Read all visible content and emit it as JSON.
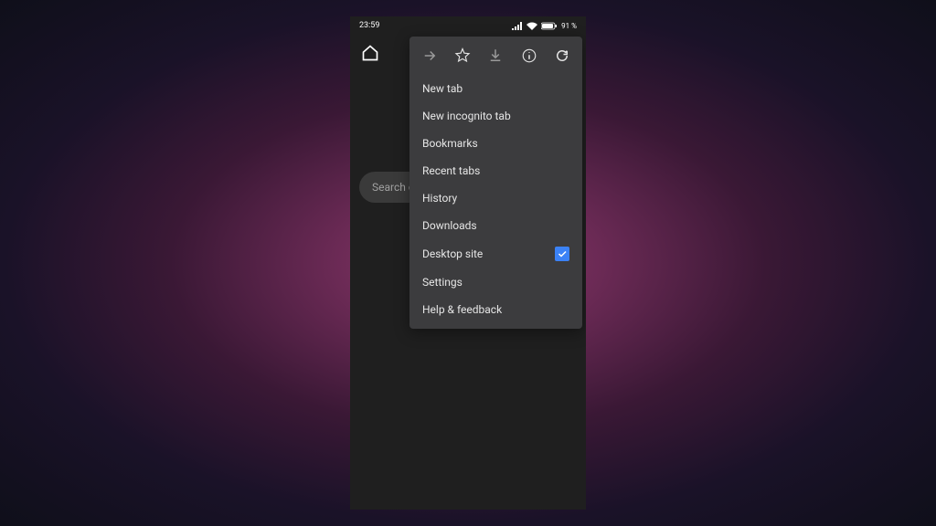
{
  "status": {
    "time": "23:59",
    "battery": "91 %"
  },
  "search": {
    "placeholder": "Search or"
  },
  "menu": {
    "items": [
      {
        "label": "New tab"
      },
      {
        "label": "New incognito tab"
      },
      {
        "label": "Bookmarks"
      },
      {
        "label": "Recent tabs"
      },
      {
        "label": "History"
      },
      {
        "label": "Downloads"
      },
      {
        "label": "Desktop site",
        "checked": true
      },
      {
        "label": "Settings"
      },
      {
        "label": "Help & feedback"
      }
    ]
  }
}
